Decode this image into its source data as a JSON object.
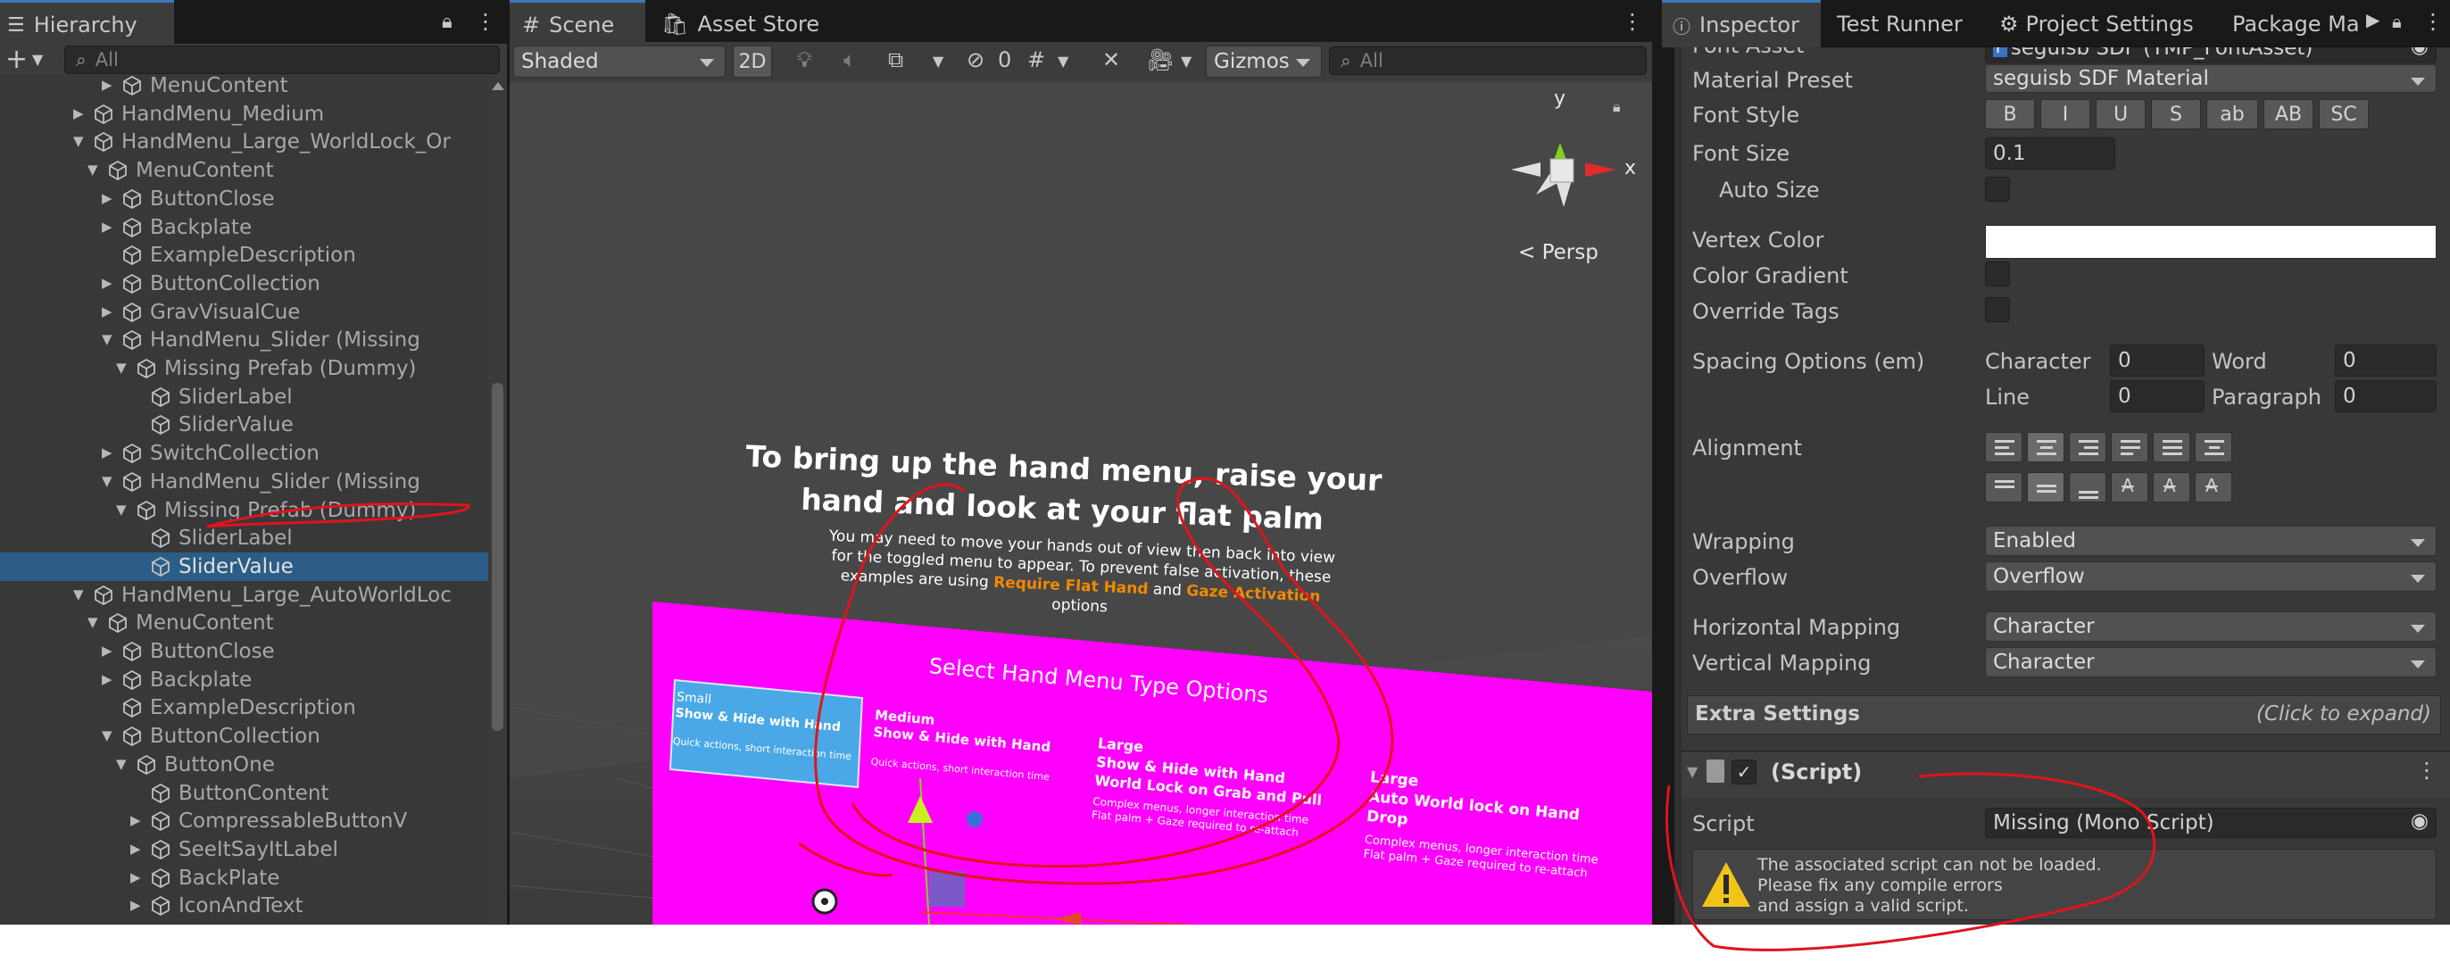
{
  "hierarchy": {
    "tab": "Hierarchy",
    "search_placeholder": "All",
    "rows": [
      {
        "label": "MenuContent",
        "indent": 6,
        "arrow": "right"
      },
      {
        "label": "HandMenu_Medium",
        "indent": 4,
        "arrow": "right"
      },
      {
        "label": "HandMenu_Large_WorldLock_Or",
        "indent": 4,
        "arrow": "down"
      },
      {
        "label": "MenuContent",
        "indent": 5,
        "arrow": "down"
      },
      {
        "label": "ButtonClose",
        "indent": 6,
        "arrow": "right"
      },
      {
        "label": "Backplate",
        "indent": 6,
        "arrow": "right"
      },
      {
        "label": "ExampleDescription",
        "indent": 6,
        "arrow": ""
      },
      {
        "label": "ButtonCollection",
        "indent": 6,
        "arrow": "right"
      },
      {
        "label": "GravVisualCue",
        "indent": 6,
        "arrow": "right"
      },
      {
        "label": "HandMenu_Slider (Missing",
        "indent": 6,
        "arrow": "down"
      },
      {
        "label": "Missing Prefab (Dummy)",
        "indent": 7,
        "arrow": "down"
      },
      {
        "label": "SliderLabel",
        "indent": 8,
        "arrow": ""
      },
      {
        "label": "SliderValue",
        "indent": 8,
        "arrow": ""
      },
      {
        "label": "SwitchCollection",
        "indent": 6,
        "arrow": "right"
      },
      {
        "label": "HandMenu_Slider (Missing",
        "indent": 6,
        "arrow": "down"
      },
      {
        "label": "Missing Prefab (Dummy)",
        "indent": 7,
        "arrow": "down"
      },
      {
        "label": "SliderLabel",
        "indent": 8,
        "arrow": ""
      },
      {
        "label": "SliderValue",
        "indent": 8,
        "arrow": "",
        "selected": true
      },
      {
        "label": "HandMenu_Large_AutoWorldLoc",
        "indent": 4,
        "arrow": "down"
      },
      {
        "label": "MenuContent",
        "indent": 5,
        "arrow": "down"
      },
      {
        "label": "ButtonClose",
        "indent": 6,
        "arrow": "right"
      },
      {
        "label": "Backplate",
        "indent": 6,
        "arrow": "right"
      },
      {
        "label": "ExampleDescription",
        "indent": 6,
        "arrow": ""
      },
      {
        "label": "ButtonCollection",
        "indent": 6,
        "arrow": "down"
      },
      {
        "label": "ButtonOne",
        "indent": 7,
        "arrow": "down"
      },
      {
        "label": "ButtonContent",
        "indent": 8,
        "arrow": ""
      },
      {
        "label": "CompressableButtonV",
        "indent": 8,
        "arrow": "right"
      },
      {
        "label": "SeeItSayItLabel",
        "indent": 8,
        "arrow": "right"
      },
      {
        "label": "BackPlate",
        "indent": 8,
        "arrow": "right"
      },
      {
        "label": "IconAndText",
        "indent": 8,
        "arrow": "right"
      }
    ]
  },
  "scene": {
    "tabs": [
      "Scene",
      "Asset Store"
    ],
    "shading": "Shaded",
    "mode_2d": "2D",
    "hidden_count": "0",
    "gizmos": "Gizmos",
    "search_placeholder": "All",
    "persp": "Persp",
    "axis_y": "y",
    "axis_x": "x",
    "heading_line1": "To bring up the hand menu, raise your",
    "heading_line2": "hand and look at your flat palm",
    "body_line1": "You may need to move your hands out of view then back into view",
    "body_line2": "for the toggled menu to appear. To prevent false activation, these",
    "body_line3_a": "examples are using",
    "body_line3_b": "Require Flat Hand",
    "body_line3_c": "and",
    "body_line3_d": "Gaze Activation",
    "body_line4": "options",
    "panel_title": "Select Hand Menu Type Options",
    "opt_small_1": "Small",
    "opt_small_2": "Show & Hide with Hand",
    "opt_small_3": "Quick actions, short interaction time",
    "opt_medium_1": "Medium",
    "opt_medium_2": "Show & Hide with Hand",
    "opt_medium_3": "Quick actions, short interaction time",
    "opt_large_1": "Large",
    "opt_large_2": "Show & Hide with Hand",
    "opt_large_3": "World Lock on Grab and Pull",
    "opt_large_4": "Complex menus, longer interaction time",
    "opt_large_5": "Flat palm + Gaze required to re-attach",
    "opt_auto_1": "Large",
    "opt_auto_2": "Auto World lock on Hand",
    "opt_auto_3": "Drop",
    "opt_auto_4": "Complex menus, longer interaction time",
    "opt_auto_5": "Flat palm + Gaze required to re-attach"
  },
  "inspector": {
    "tabs": [
      "Inspector",
      "Test Runner",
      "Project Settings",
      "Package Ma"
    ],
    "font_asset_label": "Font Asset",
    "font_asset_value": "seguisb SDF (TMP_FontAsset)",
    "material_preset_label": "Material Preset",
    "material_preset_value": "seguisb SDF Material",
    "font_style_label": "Font Style",
    "font_style_buttons": [
      "B",
      "I",
      "U",
      "S",
      "ab",
      "AB",
      "SC"
    ],
    "font_size_label": "Font Size",
    "font_size_value": "0.1",
    "auto_size_label": "Auto Size",
    "vertex_color_label": "Vertex Color",
    "vertex_color": "#ffffff",
    "color_gradient_label": "Color Gradient",
    "override_tags_label": "Override Tags",
    "spacing_label": "Spacing Options (em)",
    "spacing_character_label": "Character",
    "spacing_character_value": "0",
    "spacing_word_label": "Word",
    "spacing_word_value": "0",
    "spacing_line_label": "Line",
    "spacing_line_value": "0",
    "spacing_paragraph_label": "Paragraph",
    "spacing_paragraph_value": "0",
    "alignment_label": "Alignment",
    "wrapping_label": "Wrapping",
    "wrapping_value": "Enabled",
    "overflow_label": "Overflow",
    "overflow_value": "Overflow",
    "hmap_label": "Horizontal Mapping",
    "hmap_value": "Character",
    "vmap_label": "Vertical Mapping",
    "vmap_value": "Character",
    "extra_settings_label": "Extra Settings",
    "extra_settings_hint": "(Click to expand)",
    "script_component_title": "(Script)",
    "script_label": "Script",
    "script_value": "Missing (Mono Script)",
    "warning_line1": "The associated script can not be loaded.",
    "warning_line2": "Please fix any compile errors",
    "warning_line3": "and assign a valid script."
  },
  "colors": {
    "selection": "#2c5d87",
    "tab_accent": "#3a79bb",
    "annotation": "#e0141c",
    "menu_magenta": "#ff00ff",
    "highlight_orange": "#f08a00"
  }
}
